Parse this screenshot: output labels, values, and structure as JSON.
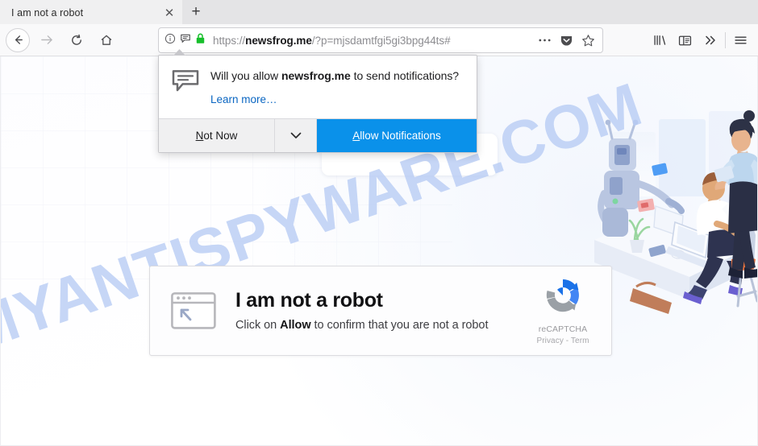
{
  "browser": {
    "tab": {
      "title": "I am not a robot",
      "close_icon": "close-icon",
      "new_tab_icon": "plus-icon"
    },
    "nav": {
      "back_icon": "back-arrow-icon",
      "forward_icon": "forward-arrow-icon",
      "reload_icon": "reload-icon",
      "home_icon": "home-icon"
    },
    "urlbar": {
      "info_icon": "info-circle-icon",
      "notification_icon": "speech-bubble-icon",
      "lock_icon": "padlock-icon",
      "scheme": "https://",
      "domain": "newsfrog.me",
      "path": "/?p=mjsdamtfgi5gi3bpg44ts#",
      "full_url": "https://newsfrog.me/?p=mjsdamtfgi5gi3bpg44ts#",
      "more_icon": "ellipsis-icon",
      "pocket_icon": "pocket-icon",
      "bookmark_icon": "star-icon"
    },
    "toolbar": {
      "library_icon": "library-icon",
      "sidebar_icon": "sidebar-icon",
      "overflow_icon": "chevrons-right-icon",
      "menu_icon": "hamburger-menu-icon"
    }
  },
  "notification_popup": {
    "icon": "notification-bubble-icon",
    "message_prefix": "Will you allow ",
    "message_domain": "newsfrog.me",
    "message_suffix": " to send notifications?",
    "learn_more": "Learn more…",
    "not_now_label": "Not Now",
    "not_now_accesskey": "N",
    "caret_icon": "chevron-down-icon",
    "allow_label": "llow Notifications",
    "allow_accesskey": "A",
    "allow_color": "#0a91ea"
  },
  "page": {
    "watermark": "MYANTISPYWARE.COM",
    "watermark_color": "#b9cdf5",
    "card": {
      "window_icon": "browser-window-cursor-icon",
      "heading": "I am not a robot",
      "sub_prefix": "Click on ",
      "sub_bold": "Allow",
      "sub_suffix": " to confirm that you are not a robot",
      "recaptcha_icon": "recaptcha-logo-icon",
      "recaptcha_label": "reCAPTCHA",
      "recaptcha_links": "Privacy - Term"
    },
    "illustration": "office-robot-workers-illustration"
  }
}
